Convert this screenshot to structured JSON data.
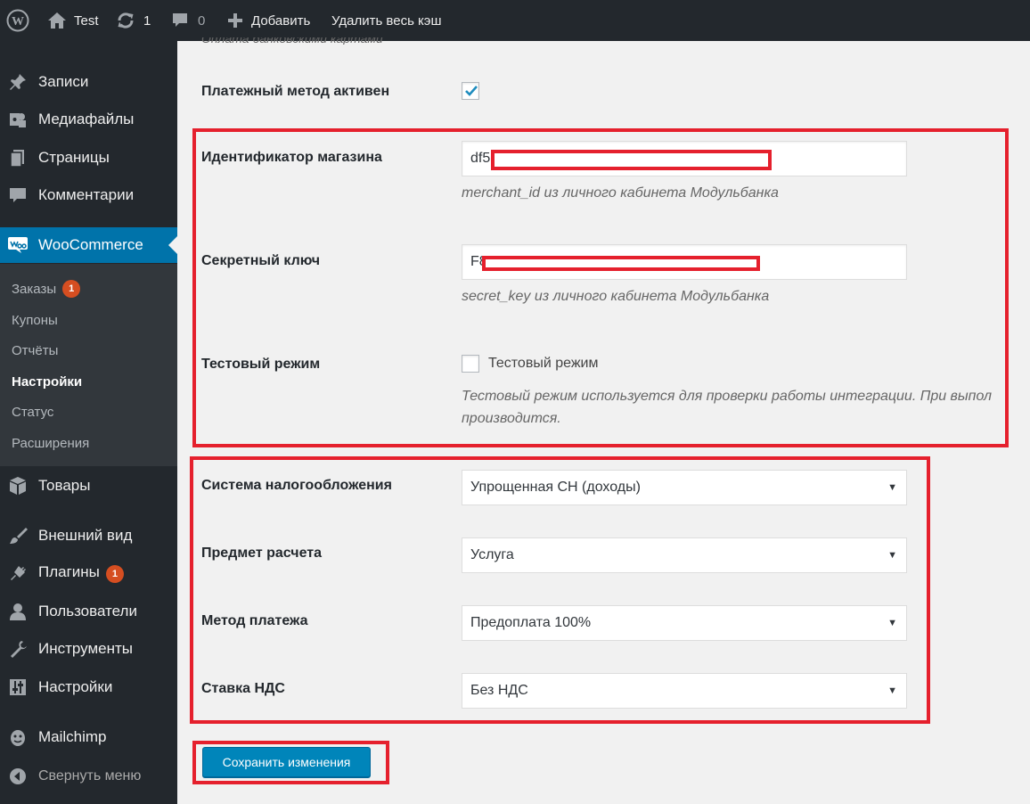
{
  "adminbar": {
    "site_name": "Test",
    "updates_count": "1",
    "comments_count": "0",
    "add_new_label": "Добавить",
    "clear_cache_label": "Удалить весь кэш"
  },
  "sidebar": {
    "items": {
      "posts": "Записи",
      "media": "Медиафайлы",
      "pages": "Страницы",
      "comments": "Комментарии",
      "woocommerce": "WooCommerce",
      "products": "Товары",
      "appearance": "Внешний вид",
      "plugins": "Плагины",
      "users": "Пользователи",
      "tools": "Инструменты",
      "settings": "Настройки",
      "mailchimp": "Mailchimp",
      "collapse": "Свернуть меню"
    },
    "plugins_badge": "1",
    "submenu": {
      "orders": "Заказы",
      "orders_badge": "1",
      "coupons": "Купоны",
      "reports": "Отчёты",
      "settings": "Настройки",
      "status": "Статус",
      "extensions": "Расширения"
    }
  },
  "form": {
    "top_clipped_text": "Оплата банковскими картами",
    "payment_active": {
      "label": "Платежный метод активен",
      "checked": true
    },
    "merchant_id": {
      "label": "Идентификатор магазина",
      "value": "df5",
      "description": "merchant_id из личного кабинета Модульбанка"
    },
    "secret_key": {
      "label": "Секретный ключ",
      "value": "F8",
      "description": "secret_key из личного кабинета Модульбанка"
    },
    "test_mode": {
      "label": "Тестовый режим",
      "checkbox_label": "Тестовый режим",
      "checked": false,
      "description_line1": "Тестовый режим используется для проверки работы интеграции. При выпол",
      "description_line2": "производится."
    },
    "tax_system": {
      "label": "Система налогообложения",
      "value": "Упрощенная СН (доходы)"
    },
    "payment_object": {
      "label": "Предмет расчета",
      "value": "Услуга"
    },
    "payment_method": {
      "label": "Метод платежа",
      "value": "Предоплата 100%"
    },
    "vat": {
      "label": "Ставка НДС",
      "value": "Без НДС"
    },
    "save_label": "Сохранить изменения"
  },
  "colors": {
    "adminbar_bg": "#23282d",
    "accent": "#0073aa",
    "highlight_border": "#e5202d",
    "button_bg": "#0085ba"
  }
}
